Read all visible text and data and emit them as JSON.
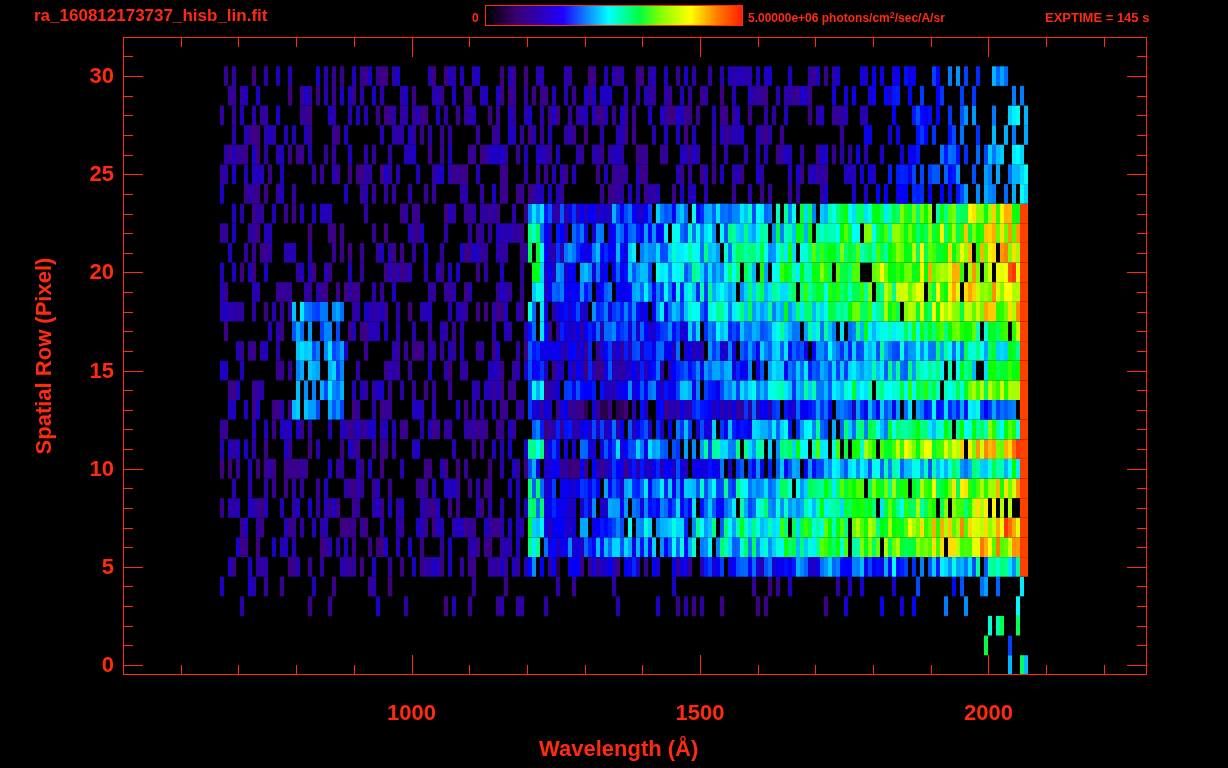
{
  "header": {
    "file_name": "ra_160812173737_hisb_lin.fit",
    "colorbar_min": "0",
    "colorbar_max": "5.00000e+06 photons/cm$^{2}$/sec/A/sr",
    "exposure": "EXPTIME = 145 s"
  },
  "plot": {
    "x_axis_label": "Wavelength (Å)",
    "y_axis_label": "Spatial Row (Pixel)",
    "x_ticks": [
      "1000",
      "1500",
      "2000"
    ],
    "y_ticks": [
      "30",
      "25",
      "20",
      "15",
      "10",
      "5",
      "0"
    ]
  }
}
